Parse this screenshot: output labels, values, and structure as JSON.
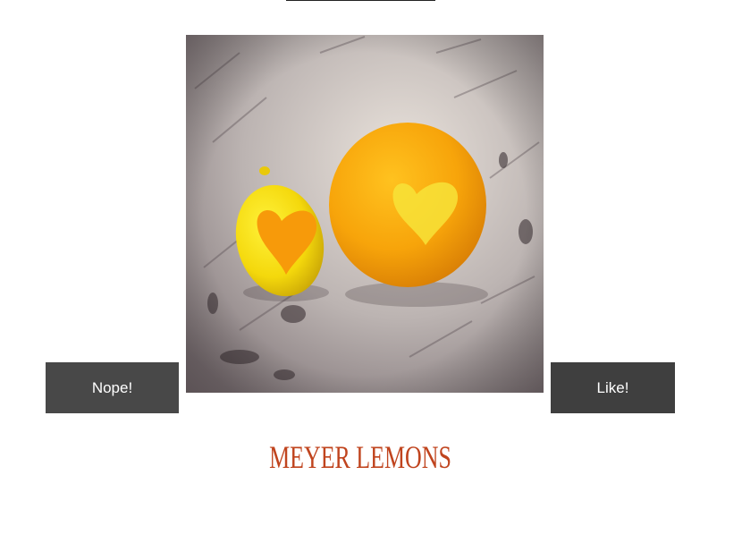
{
  "buttons": {
    "nope_label": "Nope!",
    "like_label": "Like!"
  },
  "item": {
    "title": "MEYER LEMONS"
  },
  "colors": {
    "title": "#c0441e",
    "button_bg": "#444444",
    "button_text": "#ffffff"
  }
}
